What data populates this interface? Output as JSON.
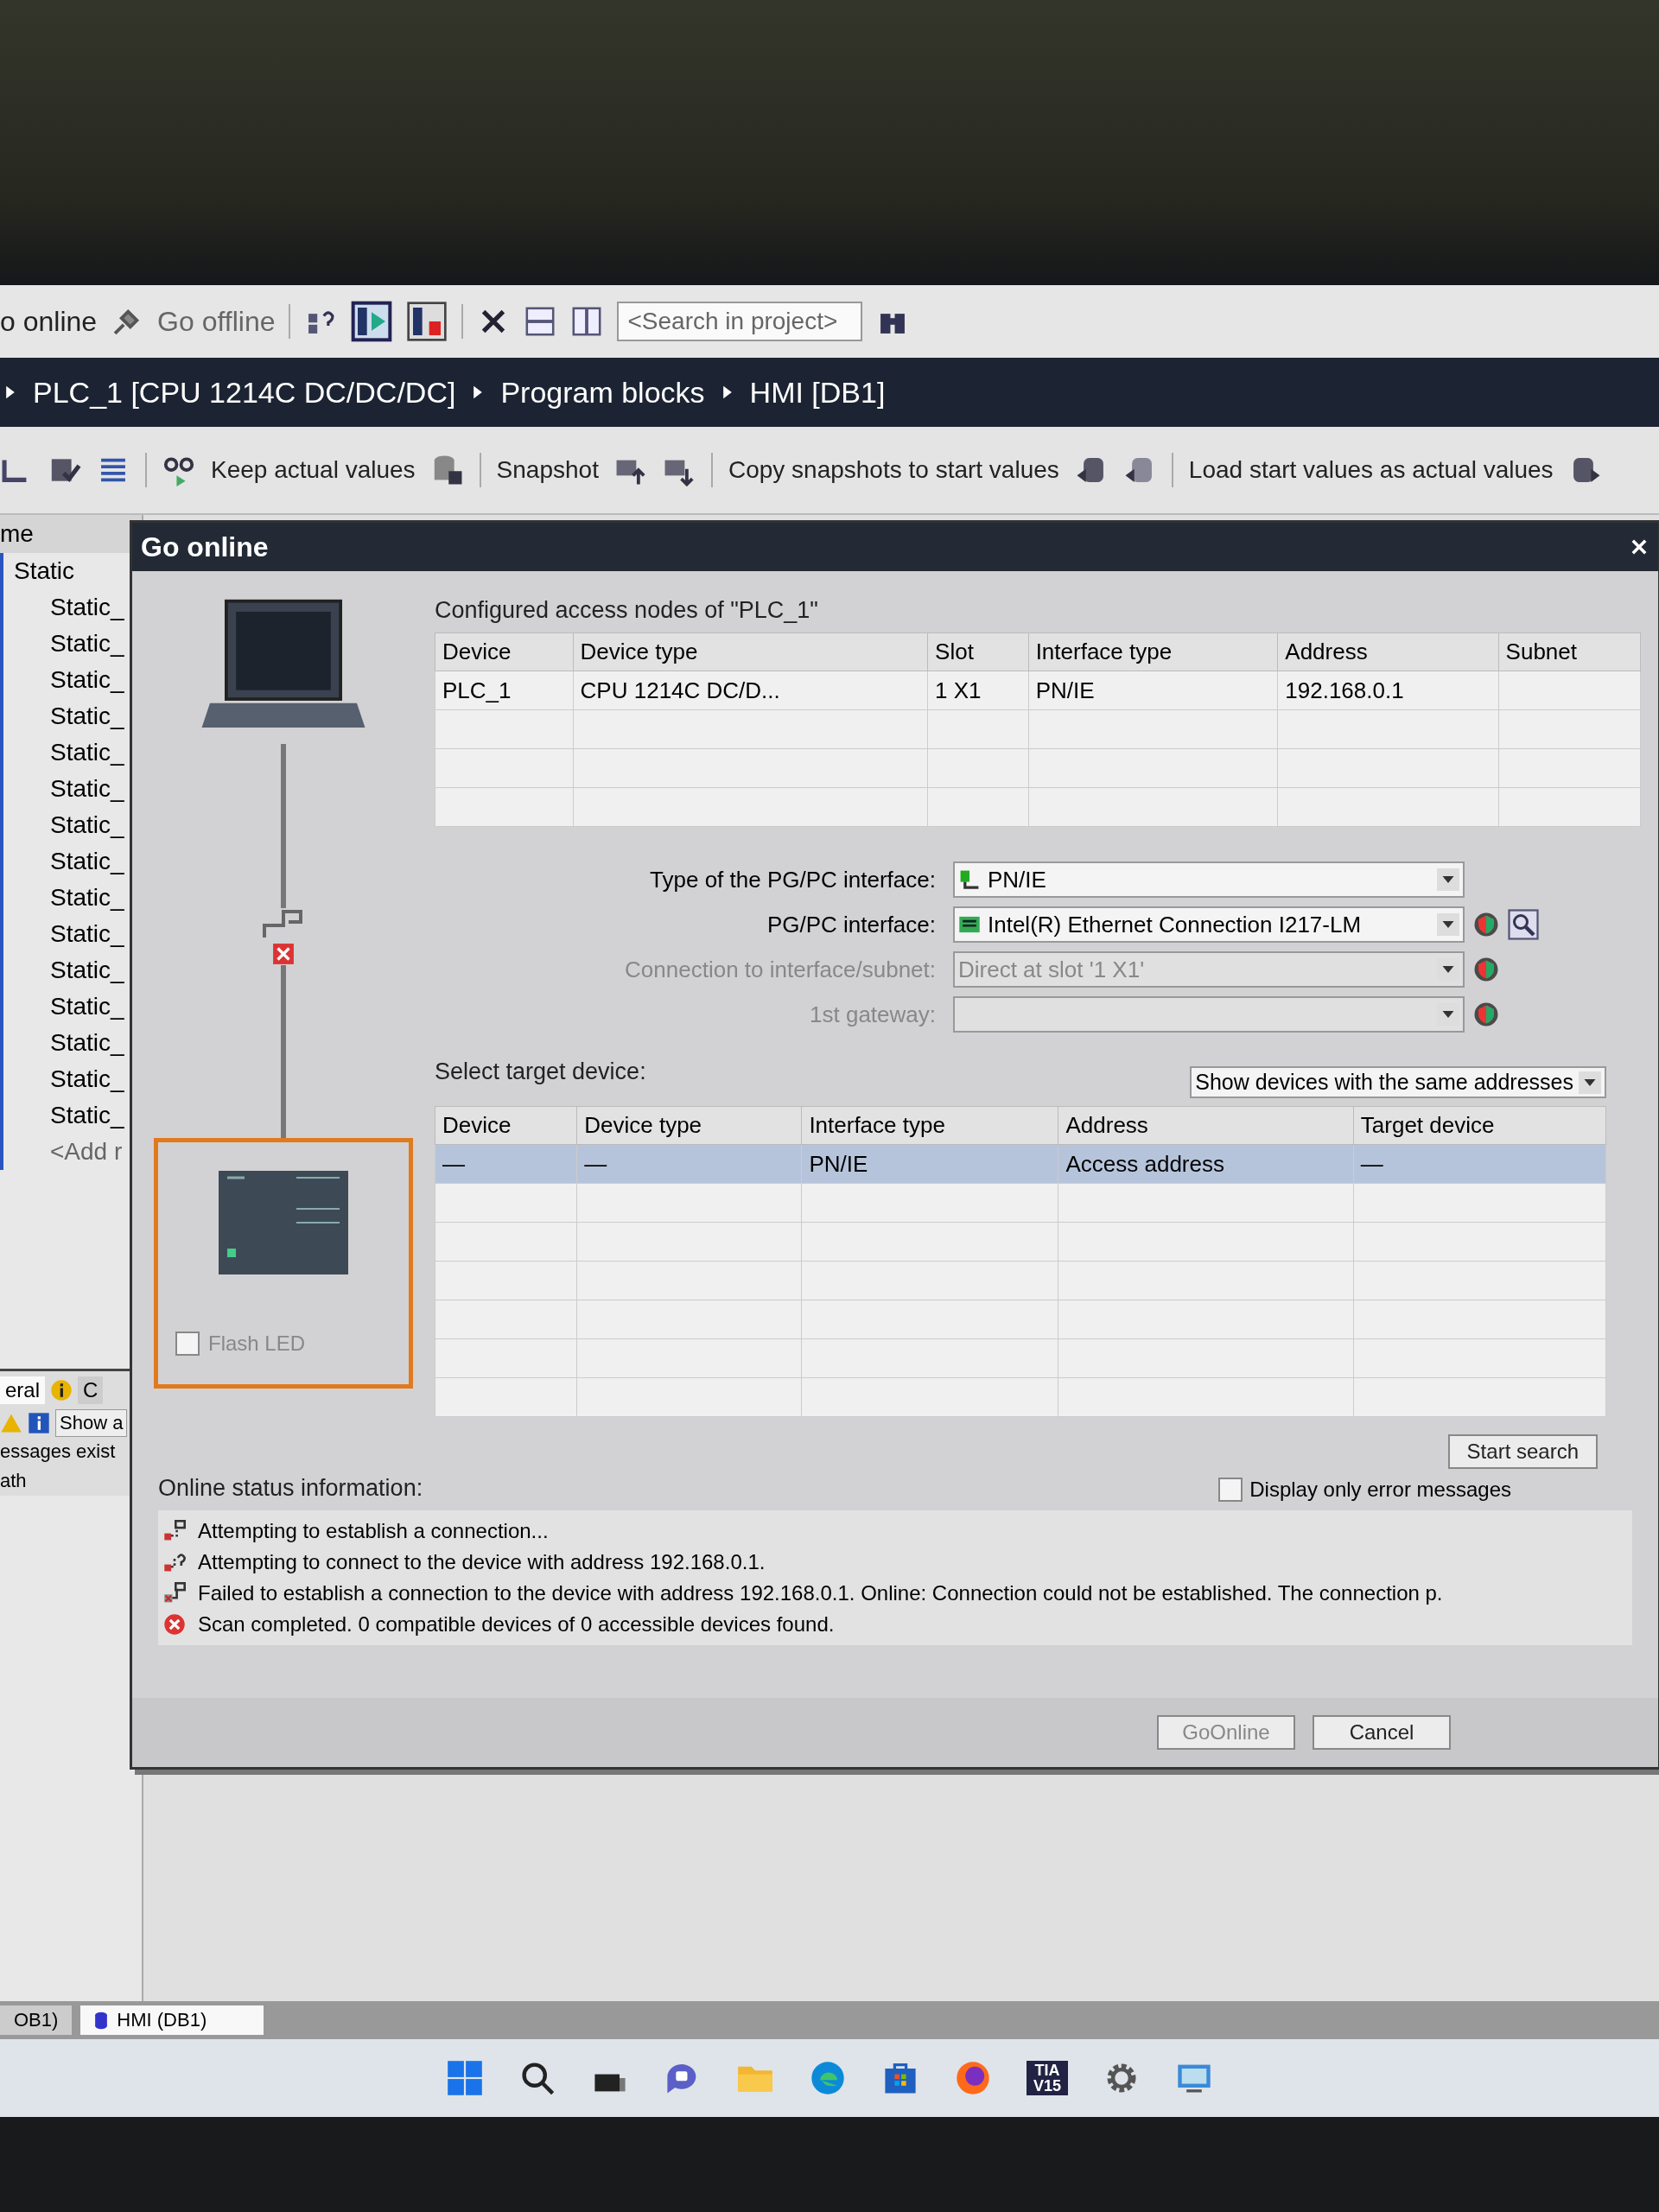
{
  "toolbar": {
    "go_online": "o online",
    "go_offline": "Go offline",
    "search_placeholder": "<Search in project>"
  },
  "breadcrumb": [
    "PLC_1 [CPU 1214C DC/DC/DC]",
    "Program blocks",
    "HMI [DB1]"
  ],
  "editor_toolbar": {
    "buttons": [
      "Keep actual values",
      "Snapshot",
      "Copy snapshots to start values",
      "Load start values as actual values"
    ]
  },
  "tag_list": {
    "header": "me",
    "items": [
      {
        "name": "Static",
        "children": [
          {
            "name": "Static_"
          },
          {
            "name": "Static_"
          },
          {
            "name": "Static_"
          },
          {
            "name": "Static_"
          },
          {
            "name": "Static_"
          },
          {
            "name": "Static_"
          },
          {
            "name": "Static_"
          },
          {
            "name": "Static_"
          },
          {
            "name": "Static_"
          },
          {
            "name": "Static_"
          },
          {
            "name": "Static_"
          },
          {
            "name": "Static_"
          },
          {
            "name": "Static_"
          },
          {
            "name": "Static_"
          },
          {
            "name": "Static_"
          }
        ]
      }
    ],
    "add_row": "<Add r"
  },
  "inspector": {
    "tabs": [
      {
        "label": "eral",
        "selected": true
      },
      {
        "label": "C",
        "selected": false
      }
    ],
    "filter_button": "Show a",
    "lines": [
      "essages exist",
      "ath"
    ]
  },
  "dialog": {
    "title": "Go online",
    "flash_led": {
      "label": "Flash LED",
      "checked": false,
      "disabled": true
    },
    "configured": {
      "title": "Configured access nodes of \"PLC_1\"",
      "columns": [
        "Device",
        "Device type",
        "Slot",
        "Interface type",
        "Address",
        "Subnet"
      ],
      "rows": [
        [
          "PLC_1",
          "CPU 1214C DC/D...",
          "1 X1",
          "PN/IE",
          "192.168.0.1"
        ]
      ]
    },
    "interface": [
      {
        "label": "Type of the PG/PC interface:",
        "value": "PN/IE",
        "disabled": false,
        "kind": "network",
        "shield": false
      },
      {
        "label": "PG/PC interface:",
        "value": "Intel(R) Ethernet Connection I217-LM",
        "disabled": false,
        "kind": "adapter",
        "shield": true
      },
      {
        "label": "Connection to interface/subnet:",
        "value": "Direct at slot '1 X1'",
        "disabled": true,
        "kind": "plain",
        "shield": true
      },
      {
        "label": "1st gateway:",
        "disabled": true,
        "kind": "plain",
        "shield": true
      }
    ],
    "target": {
      "title": "Select target device:",
      "filter": "Show devices with the same addresses",
      "columns": [
        "Device",
        "Device type",
        "Interface type",
        "Address",
        "Target device"
      ],
      "rows": [
        {
          "cells": [
            "—",
            "—",
            "PN/IE",
            "Access address",
            "—"
          ],
          "selected": true
        }
      ]
    },
    "status": {
      "title": "Online status information:",
      "start_search": "Start search",
      "error_only": {
        "label": "Display only error messages",
        "checked": false
      },
      "messages": [
        {
          "kind": "connect",
          "text": "Attempting to establish a connection..."
        },
        {
          "kind": "query",
          "text": "Attempting to connect to the device with address 192.168.0.1."
        },
        {
          "kind": "failed",
          "text": "Failed to establish a connection to the device with address 192.168.0.1. Online: Connection could not be established. The connection p."
        },
        {
          "kind": "error",
          "text": "Scan completed. 0 compatible devices of 0 accessible devices found."
        }
      ]
    },
    "buttons": [
      {
        "label": "GoOnline",
        "disabled": true
      },
      {
        "label": "Cancel",
        "disabled": false
      }
    ]
  },
  "editor_tabs": [
    {
      "label": "OB1)",
      "selected": false
    },
    {
      "label": "HMI (DB1)",
      "selected": true
    }
  ],
  "taskbar": [
    {
      "kind": "start"
    },
    {
      "kind": "search"
    },
    {
      "kind": "taskview"
    },
    {
      "kind": "chat"
    },
    {
      "kind": "folder"
    },
    {
      "kind": "browser"
    },
    {
      "kind": "store"
    },
    {
      "kind": "firefox"
    },
    {
      "kind": "tia",
      "label": "TIA V15"
    },
    {
      "kind": "gear"
    },
    {
      "kind": "app"
    }
  ]
}
